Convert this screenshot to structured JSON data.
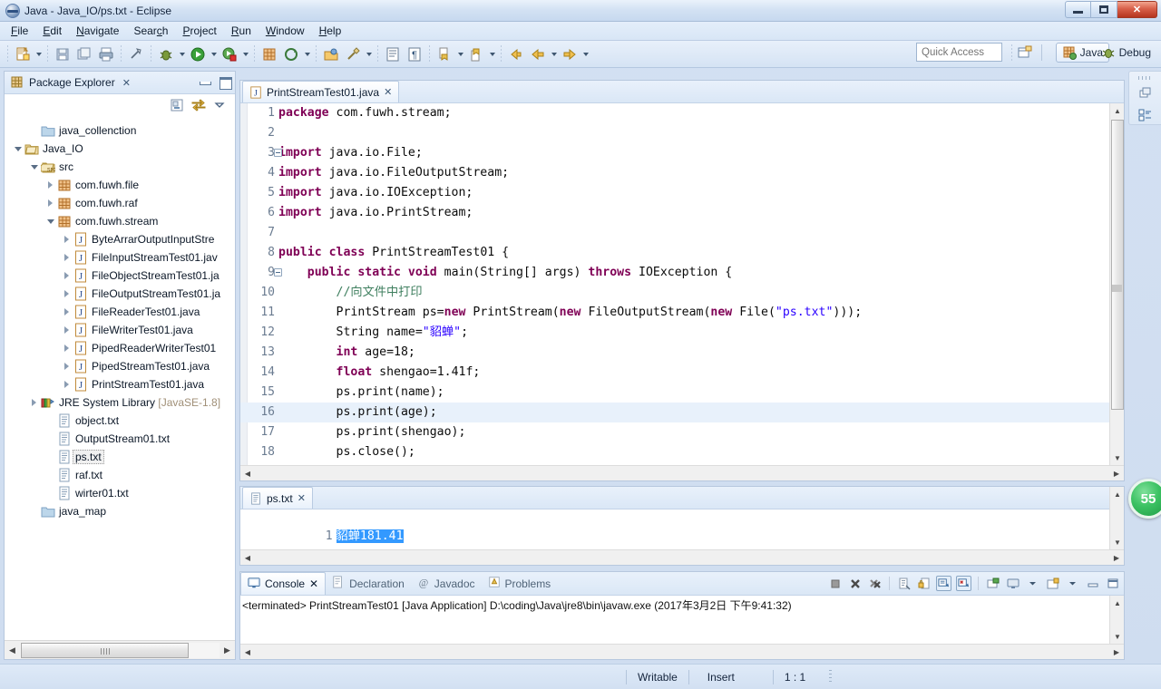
{
  "window": {
    "title": "Java - Java_IO/ps.txt - Eclipse",
    "icon": "eclipse-icon",
    "controls": {
      "minimize": "minimize-button",
      "maximize": "maximize-button",
      "close": "✕"
    }
  },
  "menu": {
    "items": [
      {
        "label": "File",
        "mnemonic": "F"
      },
      {
        "label": "Edit",
        "mnemonic": "E"
      },
      {
        "label": "Navigate",
        "mnemonic": "N"
      },
      {
        "label": "Search",
        "mnemonic": "c"
      },
      {
        "label": "Project",
        "mnemonic": "P"
      },
      {
        "label": "Run",
        "mnemonic": "R"
      },
      {
        "label": "Window",
        "mnemonic": "W"
      },
      {
        "label": "Help",
        "mnemonic": "H"
      }
    ]
  },
  "toolbar": {
    "quick_access_placeholder": "Quick Access",
    "perspective_java": "Java",
    "perspective_debug": "Debug",
    "open_perspective_tooltip": "Open Perspective"
  },
  "explorer": {
    "title": "Package Explorer",
    "close": "✕",
    "tree": [
      {
        "indent": 1,
        "twisty": "none",
        "icon": "folder-icon",
        "label": "java_collenction"
      },
      {
        "indent": 0,
        "twisty": "open",
        "icon": "project-open-icon",
        "label": "Java_IO"
      },
      {
        "indent": 1,
        "twisty": "open",
        "icon": "source-folder-icon",
        "label": "src"
      },
      {
        "indent": 2,
        "twisty": "closed",
        "icon": "package-icon",
        "label": "com.fuwh.file"
      },
      {
        "indent": 2,
        "twisty": "closed",
        "icon": "package-icon",
        "label": "com.fuwh.raf"
      },
      {
        "indent": 2,
        "twisty": "open",
        "icon": "package-icon",
        "label": "com.fuwh.stream"
      },
      {
        "indent": 3,
        "twisty": "closed",
        "icon": "java-file-icon",
        "label": "ByteArrarOutputInputStre"
      },
      {
        "indent": 3,
        "twisty": "closed",
        "icon": "java-file-icon",
        "label": "FileInputStreamTest01.jav"
      },
      {
        "indent": 3,
        "twisty": "closed",
        "icon": "java-file-icon",
        "label": "FileObjectStreamTest01.ja"
      },
      {
        "indent": 3,
        "twisty": "closed",
        "icon": "java-file-icon",
        "label": "FileOutputStreamTest01.ja"
      },
      {
        "indent": 3,
        "twisty": "closed",
        "icon": "java-file-icon",
        "label": "FileReaderTest01.java"
      },
      {
        "indent": 3,
        "twisty": "closed",
        "icon": "java-file-icon",
        "label": "FileWriterTest01.java"
      },
      {
        "indent": 3,
        "twisty": "closed",
        "icon": "java-file-icon",
        "label": "PipedReaderWriterTest01"
      },
      {
        "indent": 3,
        "twisty": "closed",
        "icon": "java-file-icon",
        "label": "PipedStreamTest01.java"
      },
      {
        "indent": 3,
        "twisty": "closed",
        "icon": "java-file-icon",
        "label": "PrintStreamTest01.java"
      },
      {
        "indent": 1,
        "twisty": "closed",
        "icon": "library-icon",
        "label": "JRE System Library",
        "suffix": "[JavaSE-1.8]"
      },
      {
        "indent": 2,
        "twisty": "none",
        "icon": "text-file-icon",
        "label": "object.txt"
      },
      {
        "indent": 2,
        "twisty": "none",
        "icon": "text-file-icon",
        "label": "OutputStream01.txt"
      },
      {
        "indent": 2,
        "twisty": "none",
        "icon": "text-file-icon",
        "label": "ps.txt",
        "selected": true
      },
      {
        "indent": 2,
        "twisty": "none",
        "icon": "text-file-icon",
        "label": "raf.txt"
      },
      {
        "indent": 2,
        "twisty": "none",
        "icon": "text-file-icon",
        "label": "wirter01.txt"
      },
      {
        "indent": 1,
        "twisty": "none",
        "icon": "folder-icon",
        "label": "java_map"
      }
    ]
  },
  "editor": {
    "tab": {
      "label": "PrintStreamTest01.java",
      "icon": "java-file-icon",
      "close": "✕"
    },
    "lines": [
      {
        "num": "1",
        "fold": false,
        "tokens": [
          {
            "t": "kw",
            "v": "package"
          },
          {
            "t": "ctxt",
            "v": " com.fuwh.stream;"
          }
        ]
      },
      {
        "num": "2",
        "fold": false,
        "tokens": []
      },
      {
        "num": "3",
        "fold": true,
        "tokens": [
          {
            "t": "kw",
            "v": "import"
          },
          {
            "t": "ctxt",
            "v": " java.io.File;"
          }
        ]
      },
      {
        "num": "4",
        "fold": false,
        "tokens": [
          {
            "t": "kw",
            "v": "import"
          },
          {
            "t": "ctxt",
            "v": " java.io.FileOutputStream;"
          }
        ]
      },
      {
        "num": "5",
        "fold": false,
        "tokens": [
          {
            "t": "kw",
            "v": "import"
          },
          {
            "t": "ctxt",
            "v": " java.io.IOException;"
          }
        ]
      },
      {
        "num": "6",
        "fold": false,
        "tokens": [
          {
            "t": "kw",
            "v": "import"
          },
          {
            "t": "ctxt",
            "v": " java.io.PrintStream;"
          }
        ]
      },
      {
        "num": "7",
        "fold": false,
        "tokens": []
      },
      {
        "num": "8",
        "fold": false,
        "tokens": [
          {
            "t": "kw",
            "v": "public class"
          },
          {
            "t": "ctxt",
            "v": " PrintStreamTest01 {"
          }
        ]
      },
      {
        "num": "9",
        "fold": true,
        "tokens": [
          {
            "t": "ctxt",
            "v": "    "
          },
          {
            "t": "kw",
            "v": "public static void"
          },
          {
            "t": "ctxt",
            "v": " main(String[] args) "
          },
          {
            "t": "kw",
            "v": "throws"
          },
          {
            "t": "ctxt",
            "v": " IOException {"
          }
        ]
      },
      {
        "num": "10",
        "fold": false,
        "tokens": [
          {
            "t": "ctxt",
            "v": "        "
          },
          {
            "t": "cmt",
            "v": "//向文件中打印"
          }
        ]
      },
      {
        "num": "11",
        "fold": false,
        "tokens": [
          {
            "t": "ctxt",
            "v": "        PrintStream ps="
          },
          {
            "t": "kw",
            "v": "new"
          },
          {
            "t": "ctxt",
            "v": " PrintStream("
          },
          {
            "t": "kw",
            "v": "new"
          },
          {
            "t": "ctxt",
            "v": " FileOutputStream("
          },
          {
            "t": "kw",
            "v": "new"
          },
          {
            "t": "ctxt",
            "v": " File("
          },
          {
            "t": "str",
            "v": "\"ps.txt\""
          },
          {
            "t": "ctxt",
            "v": ")));"
          }
        ]
      },
      {
        "num": "12",
        "fold": false,
        "tokens": [
          {
            "t": "ctxt",
            "v": "        String name="
          },
          {
            "t": "str",
            "v": "\"貂蝉\""
          },
          {
            "t": "ctxt",
            "v": ";"
          }
        ]
      },
      {
        "num": "13",
        "fold": false,
        "tokens": [
          {
            "t": "ctxt",
            "v": "        "
          },
          {
            "t": "kw",
            "v": "int"
          },
          {
            "t": "ctxt",
            "v": " age=18;"
          }
        ]
      },
      {
        "num": "14",
        "fold": false,
        "tokens": [
          {
            "t": "ctxt",
            "v": "        "
          },
          {
            "t": "kw",
            "v": "float"
          },
          {
            "t": "ctxt",
            "v": " shengao=1.41f;"
          }
        ]
      },
      {
        "num": "15",
        "fold": false,
        "tokens": [
          {
            "t": "ctxt",
            "v": "        ps.print(name);"
          }
        ]
      },
      {
        "num": "16",
        "fold": false,
        "current": true,
        "tokens": [
          {
            "t": "ctxt",
            "v": "        ps.print(age);"
          }
        ]
      },
      {
        "num": "17",
        "fold": false,
        "tokens": [
          {
            "t": "ctxt",
            "v": "        ps.print(shengao);"
          }
        ]
      },
      {
        "num": "18",
        "fold": false,
        "tokens": [
          {
            "t": "ctxt",
            "v": "        ps.close();"
          }
        ]
      }
    ]
  },
  "text_editor": {
    "tab": {
      "label": "ps.txt",
      "icon": "text-file-icon",
      "close": "✕"
    },
    "line_number": "1",
    "content": "貂蝉181.41",
    "selected": true
  },
  "console": {
    "tabs": [
      {
        "label": "Problems",
        "icon": "problems-icon",
        "active": false
      },
      {
        "label": "Javadoc",
        "icon": "javadoc-icon",
        "active": false
      },
      {
        "label": "Declaration",
        "icon": "declaration-icon",
        "active": false
      },
      {
        "label": "Console",
        "icon": "console-icon",
        "active": true,
        "close": "✕"
      }
    ],
    "output": "<terminated> PrintStreamTest01 [Java Application] D:\\coding\\Java\\jre8\\bin\\javaw.exe (2017年3月2日 下午9:41:32)",
    "tools": [
      "terminate-icon",
      "remove-launch-icon",
      "remove-all-launches-icon",
      "clear-console-icon",
      "lock-scroll-icon",
      "show-console-on-output-icon",
      "show-console-on-error-icon",
      "pin-console-icon",
      "display-console-icon",
      "open-console-icon",
      "minimize-icon",
      "maximize-icon"
    ]
  },
  "fastview": {
    "items": [
      "restore-icon",
      "outline-icon"
    ]
  },
  "badge": {
    "value": "55"
  },
  "statusbar": {
    "writable": "Writable",
    "insert": "Insert",
    "position": "1 : 1"
  },
  "colors": {
    "keyword": "#7f0055",
    "string": "#2a00ff",
    "comment": "#3f7f5f",
    "selection": "#3399ff",
    "current_line": "#e8f1fb",
    "badge_green": "#3cc263"
  }
}
